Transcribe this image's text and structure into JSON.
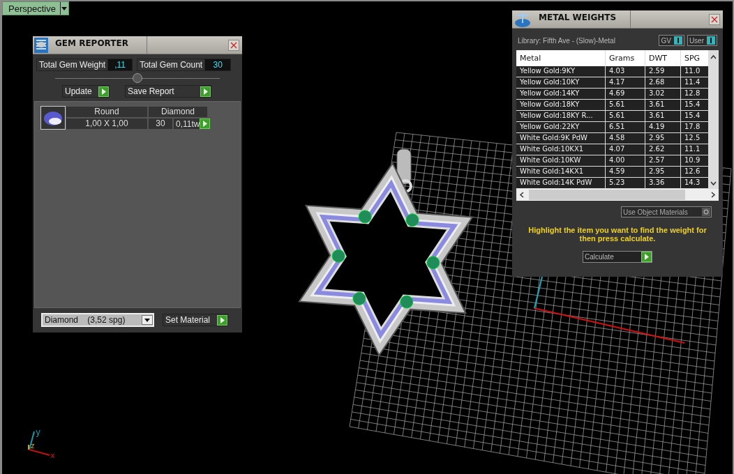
{
  "viewport": {
    "label": "Perspective"
  },
  "gem_reporter": {
    "title": "GEM REPORTER",
    "stats": [
      {
        "label": "Total Gem Weight",
        "value": ",11"
      },
      {
        "label": "Total Gem Count",
        "value": "30"
      }
    ],
    "slider": {
      "level": 0.5
    },
    "buttons": [
      "Update",
      "Save Report"
    ],
    "gems": [
      {
        "shape": "Round",
        "material": "Diamond",
        "size": "1,00 X 1,00",
        "count": "30",
        "weight": "0,11tw"
      }
    ],
    "material": {
      "value": "Diamond    (3,52 spg)"
    },
    "set_button": "Set Material"
  },
  "metal_weights": {
    "title": "METAL WEIGHTS",
    "library": "Library: Fifth Ave - (Slow)-Metal",
    "toggles": [
      {
        "label": "GV",
        "on": true
      },
      {
        "label": "User",
        "on": true
      }
    ],
    "columns": [
      "Metal",
      "Grams",
      "DWT",
      "SPG"
    ],
    "rows": [
      [
        "Yellow Gold:9KY",
        "4.03",
        "2.59",
        "11.0"
      ],
      [
        "Yellow Gold:10KY",
        "4.17",
        "2.68",
        "11.4"
      ],
      [
        "Yellow Gold:14KY",
        "4.69",
        "3.02",
        "12.8"
      ],
      [
        "Yellow Gold:18KY",
        "5.61",
        "3.61",
        "15.4"
      ],
      [
        "Yellow Gold:18KY R...",
        "5.61",
        "3.61",
        "15.4"
      ],
      [
        "Yellow Gold:22KY",
        "6.51",
        "4.19",
        "17.8"
      ],
      [
        "White Gold:9K PdW",
        "4.58",
        "2.95",
        "12.5"
      ],
      [
        "White Gold:10KX1",
        "4.07",
        "2.62",
        "11.1"
      ],
      [
        "White Gold:10KW",
        "4.00",
        "2.57",
        "10.9"
      ],
      [
        "White Gold:14KX1",
        "4.59",
        "2.95",
        "12.6"
      ],
      [
        "White Gold:14K PdW",
        "5.23",
        "3.36",
        "14.3"
      ]
    ],
    "use_object": {
      "label": "Use Object Materials",
      "on": false
    },
    "hint": "Highlight the item you want to find the weight for then press calculate.",
    "calculate": "Calculate"
  },
  "axes": {
    "labels": [
      "y",
      "z",
      "x"
    ]
  }
}
